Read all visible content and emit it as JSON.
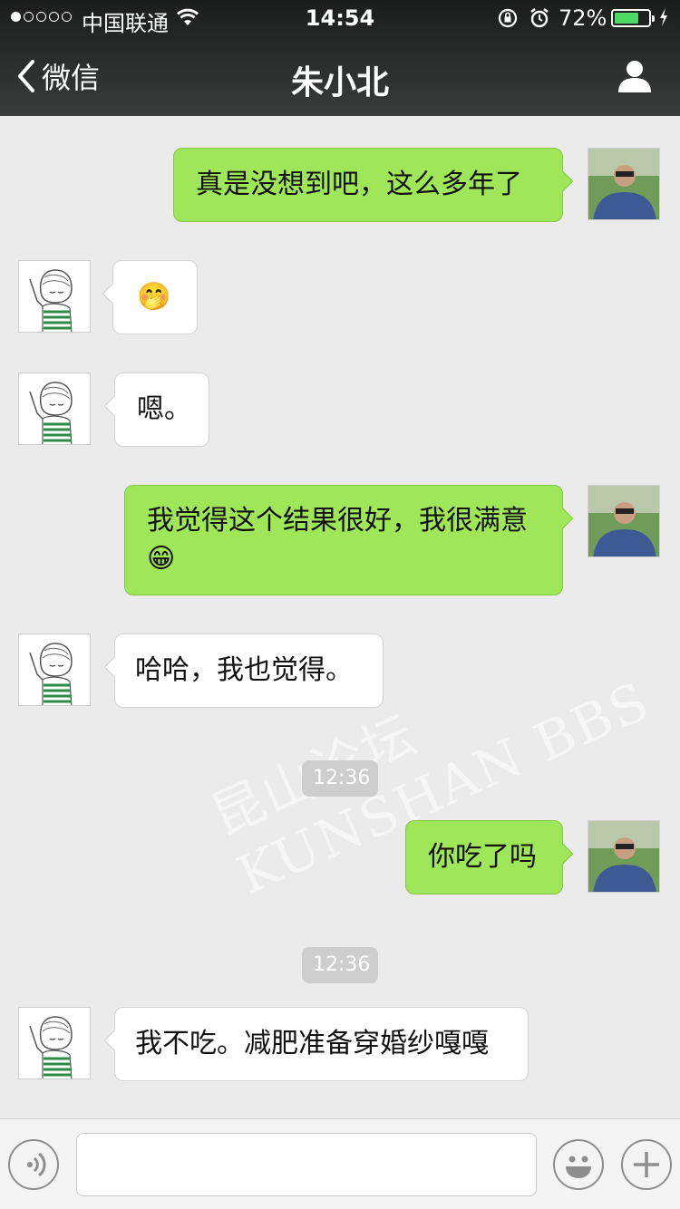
{
  "status_bar": {
    "carrier": "中国联通",
    "time": "14:54",
    "battery_percent_label": "72%",
    "battery_level": 0.72,
    "signal_bars_filled": 1,
    "signal_bars_total": 5,
    "icons": [
      "wifi-icon",
      "rotation-lock-icon",
      "alarm-icon",
      "battery-icon",
      "charging-icon"
    ]
  },
  "nav": {
    "back_label": "微信",
    "title": "朱小北",
    "right_icon": "profile-icon"
  },
  "messages": [
    {
      "side": "out",
      "text": "真是没想到吧，这么多年了"
    },
    {
      "side": "in",
      "text": "🤭"
    },
    {
      "side": "in",
      "text": "嗯。"
    },
    {
      "side": "out",
      "text": "我觉得这个结果很好，我很满意😁"
    },
    {
      "side": "in",
      "text": "哈哈，我也觉得。"
    },
    {
      "type": "timestamp",
      "text": "12:36"
    },
    {
      "side": "out",
      "text": "你吃了吗"
    },
    {
      "type": "timestamp",
      "text": "12:36"
    },
    {
      "side": "in",
      "text": "我不吃。减肥准备穿婚纱嘎嘎"
    }
  ],
  "watermark": "昆山论坛 KUNSHAN BBS",
  "input_bar": {
    "value": "",
    "left_icon": "voice-icon",
    "right_icons": [
      "emoji-icon",
      "plus-icon"
    ]
  },
  "colors": {
    "outgoing_bubble": "#9fe658",
    "incoming_bubble": "#ffffff",
    "chat_background": "#ebebeb",
    "battery_fill": "#4cd964"
  }
}
